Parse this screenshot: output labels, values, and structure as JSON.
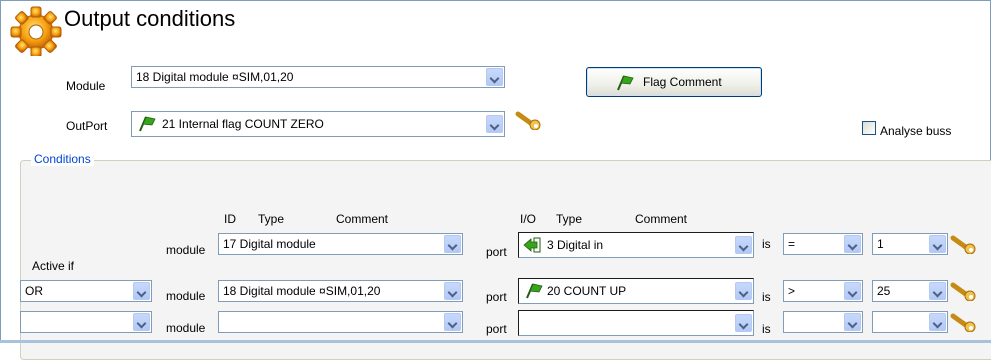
{
  "window": {
    "title": "Output conditions"
  },
  "colors": {
    "border": "#7f9db9",
    "legend": "#0046d5",
    "groupbg": "#f4f4f4",
    "flag": "#36a51a"
  },
  "module": {
    "label": "Module",
    "value": "18 Digital module  ¤SIM,01,20"
  },
  "outport": {
    "label": "OutPort",
    "value": "21 Internal flag COUNT ZERO",
    "icon": "flag-icon"
  },
  "flag_comment_button": {
    "label": "Flag Comment",
    "icon": "flag-icon"
  },
  "analyse_buss": {
    "label": "Analyse buss",
    "checked": false
  },
  "conditions": {
    "legend": "Conditions",
    "headers": {
      "id": "ID",
      "type": "Type",
      "comment": "Comment",
      "io": "I/O",
      "io_type": "Type",
      "io_comment": "Comment"
    },
    "active_if_label": "Active if",
    "module_label": "module",
    "port_label": "port",
    "is_label": "is",
    "rows": [
      {
        "logic": "",
        "module": "17 Digital module",
        "port": "3  Digital in",
        "port_icon": "arrow-in-icon",
        "op": "=",
        "value": "1"
      },
      {
        "logic": "OR",
        "module": "18 Digital module  ¤SIM,01,20",
        "port": "20 COUNT UP",
        "port_icon": "flag-icon",
        "op": ">",
        "value": "25"
      },
      {
        "logic": "",
        "module": "",
        "port": "",
        "port_icon": "",
        "op": "",
        "value": ""
      }
    ]
  }
}
